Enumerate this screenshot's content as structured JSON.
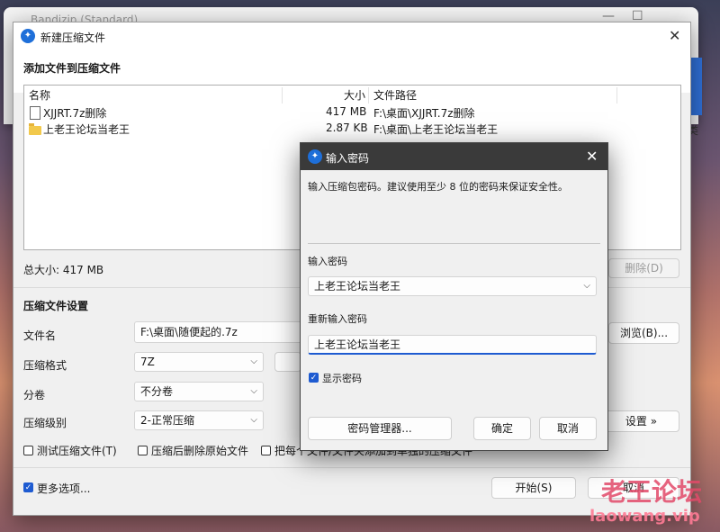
{
  "background_app": {
    "title": "Bandizip (Standard)",
    "minimize_glyph": "—",
    "maximize_glyph": "☐",
    "edge_text": "类"
  },
  "main_dialog": {
    "title": "新建压缩文件",
    "heading": "添加文件到压缩文件",
    "columns": {
      "name": "名称",
      "size": "大小",
      "path": "文件路径"
    },
    "files": [
      {
        "name": "XJJRT.7z删除",
        "size": "417 MB",
        "path": "F:\\桌面\\XJJRT.7z删除",
        "icon": "file-icon"
      },
      {
        "name": "上老王论坛当老王",
        "size": "2.87 KB",
        "path": "F:\\桌面\\上老王论坛当老王",
        "icon": "folder-icon"
      }
    ],
    "total_size": "总大小: 417 MB",
    "delete_button": "删除(D)",
    "settings_heading": "压缩文件设置",
    "filename_label": "文件名",
    "filename_value": "F:\\桌面\\随便起的.7z",
    "browse_button": "浏览(B)...",
    "format_label": "压缩格式",
    "format_value": "7Z",
    "split_label": "分卷",
    "split_value": "不分卷",
    "level_label": "压缩级别",
    "level_value": "2-正常压缩",
    "settings_button": "设置 »",
    "opt_test": "测试压缩文件(T)",
    "opt_delete": "压缩后删除原始文件",
    "opt_each": "把每个文件/文件夹添加到单独的压缩文件",
    "more_options": "更多选项...",
    "start_button": "开始(S)",
    "cancel_button": "取消"
  },
  "password_dialog": {
    "title": "输入密码",
    "description": "输入压缩包密码。建议使用至少 8 位的密码来保证安全性。",
    "password_label": "输入密码",
    "password_value": "上老王论坛当老王",
    "reenter_label": "重新输入密码",
    "reenter_value": "上老王论坛当老王",
    "show_password": "显示密码",
    "manager_button": "密码管理器...",
    "ok_button": "确定",
    "cancel_button": "取消"
  },
  "watermark": {
    "line1": "老王论坛",
    "line2": "laowang.vip"
  },
  "colors": {
    "accent": "#1e5bd1",
    "title_dark": "#3a3a3a"
  }
}
